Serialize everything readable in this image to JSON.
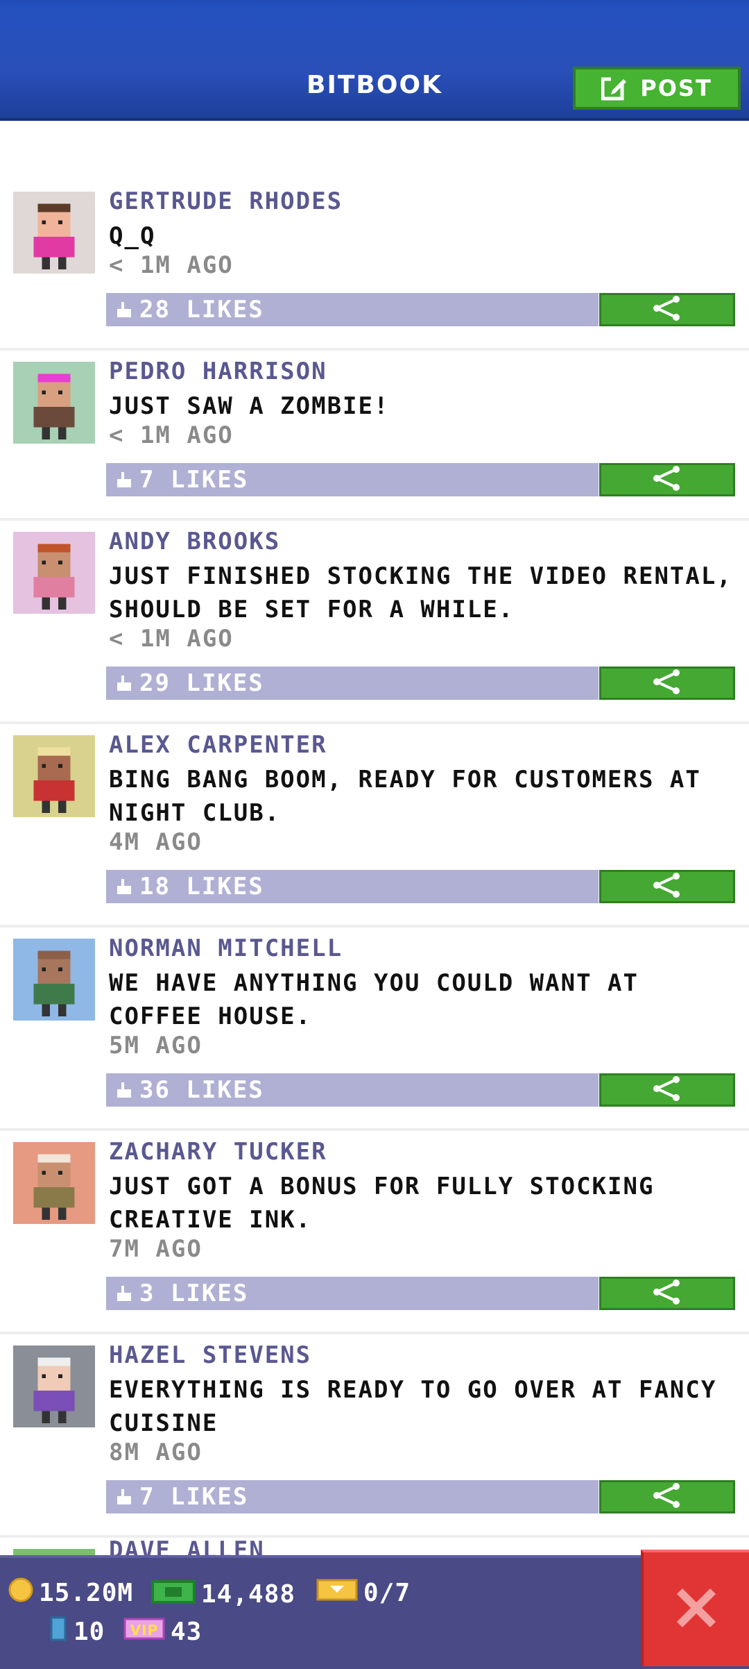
{
  "header": {
    "title": "BITBOOK",
    "post_label": "POST",
    "post_icon": "edit-icon"
  },
  "posts": [
    {
      "name": "GERTRUDE RHODES",
      "message": "Q_Q",
      "time": "< 1M AGO",
      "likes": "28 LIKES",
      "avatar_bg": "#e0d8d6",
      "shirt": "#e23aa3",
      "hair": "#5b3b27",
      "skin": "#f0b49a"
    },
    {
      "name": "PEDRO HARRISON",
      "message": "JUST SAW A ZOMBIE!",
      "time": "< 1M AGO",
      "likes": "7 LIKES",
      "avatar_bg": "#a8d0b4",
      "shirt": "#6b4a3c",
      "hair": "#e83fd2",
      "skin": "#d8a080"
    },
    {
      "name": "ANDY BROOKS",
      "message": "JUST FINISHED STOCKING THE VIDEO RENTAL, SHOULD BE SET FOR A WHILE.",
      "time": "< 1M AGO",
      "likes": "29 LIKES",
      "avatar_bg": "#e4c2e0",
      "shirt": "#e07fa0",
      "hair": "#c0542a",
      "skin": "#c89070"
    },
    {
      "name": "ALEX CARPENTER",
      "message": "BING BANG BOOM, READY FOR CUSTOMERS AT NIGHT CLUB.",
      "time": "4M AGO",
      "likes": "18 LIKES",
      "avatar_bg": "#d8d28e",
      "shirt": "#c83232",
      "hair": "#f0e0a0",
      "skin": "#a86a50"
    },
    {
      "name": "NORMAN MITCHELL",
      "message": "WE HAVE ANYTHING YOU COULD WANT AT COFFEE HOUSE.",
      "time": "5M AGO",
      "likes": "36 LIKES",
      "avatar_bg": "#8fb8e6",
      "shirt": "#3f7a4a",
      "hair": "#8c6048",
      "skin": "#a8765c"
    },
    {
      "name": "ZACHARY TUCKER",
      "message": "JUST GOT A BONUS FOR FULLY STOCKING CREATIVE INK.",
      "time": "7M AGO",
      "likes": "3 LIKES",
      "avatar_bg": "#e69a82",
      "shirt": "#8a7a4a",
      "hair": "#f2e6d8",
      "skin": "#c89070"
    },
    {
      "name": "HAZEL STEVENS",
      "message": "EVERYTHING IS READY TO GO OVER AT FANCY CUISINE",
      "time": "8M AGO",
      "likes": "7 LIKES",
      "avatar_bg": "#8a8e96",
      "shirt": "#7a4fb8",
      "hair": "#eeeeee",
      "skin": "#f0cbb8"
    }
  ],
  "peek_name": "DAVE ALLEN",
  "footer": {
    "coins": "15.20M",
    "bux": "14,488",
    "tickets": "0/7",
    "items": "10",
    "vip": "43"
  },
  "icons": {
    "thumb": "thumb-up-icon",
    "share": "share-icon",
    "close": "close-icon"
  }
}
